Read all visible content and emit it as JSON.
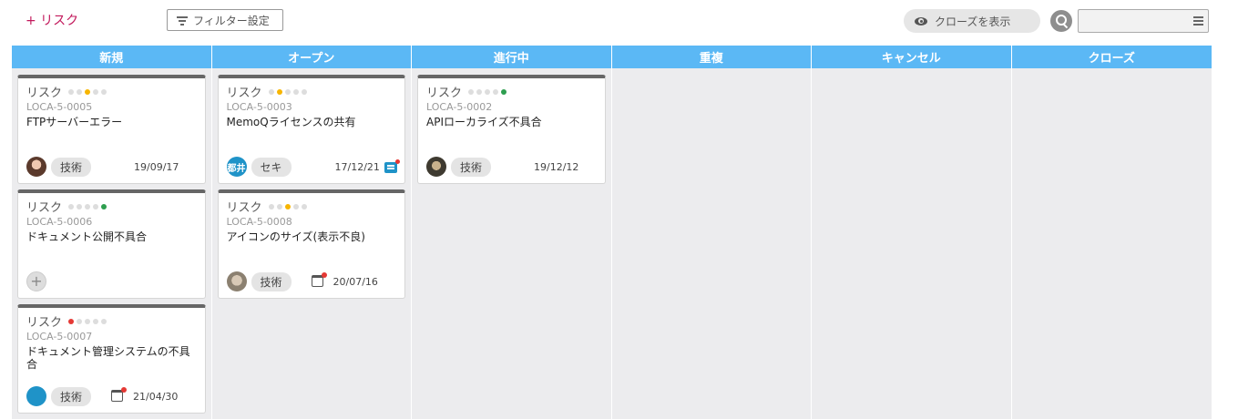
{
  "toolbar": {
    "add_label": "+ リスク",
    "filter_label": "フィルター設定",
    "show_closed_label": "クローズを表示",
    "search_placeholder": ""
  },
  "colors": {
    "column_header": "#5bb8f5",
    "board_bg": "#ececee",
    "priority_orange": "#f7b500",
    "priority_yellow": "#f4c042",
    "priority_green": "#2e9e4f",
    "priority_red": "#e53935",
    "add_link": "#c2185b"
  },
  "columns": [
    {
      "name": "新規",
      "cards": [
        {
          "type": "リスク",
          "priority": 3,
          "id": "LOCA-5-0005",
          "title": "FTPサーバーエラー",
          "tag": "技術",
          "date": "19/09/17",
          "avatar": "photo",
          "due_icon": false,
          "comment_icon": false
        },
        {
          "type": "リスク",
          "priority": 5,
          "id": "LOCA-5-0006",
          "title": "ドキュメント公開不具合",
          "tag": "",
          "date": "",
          "avatar": "add",
          "due_icon": false,
          "comment_icon": false
        },
        {
          "type": "リスク",
          "priority": 1,
          "id": "LOCA-5-0007",
          "title": "ドキュメント管理システムの不具合",
          "tag": "技術",
          "date": "21/04/30",
          "avatar": "photo",
          "due_icon": true,
          "comment_icon": false
        }
      ]
    },
    {
      "name": "オープン",
      "cards": [
        {
          "type": "リスク",
          "priority": 2,
          "id": "LOCA-5-0003",
          "title": "MemoQライセンスの共有",
          "tag": "セキ",
          "date": "17/12/21",
          "avatar": "都井",
          "due_icon": false,
          "comment_icon": true
        },
        {
          "type": "リスク",
          "priority": 3,
          "id": "LOCA-5-0008",
          "title": "アイコンのサイズ(表示不良)",
          "tag": "技術",
          "date": "20/07/16",
          "avatar": "photo",
          "due_icon": true,
          "comment_icon": false
        }
      ]
    },
    {
      "name": "進行中",
      "cards": [
        {
          "type": "リスク",
          "priority": 5,
          "id": "LOCA-5-0002",
          "title": "APIローカライズ不具合",
          "tag": "技術",
          "date": "19/12/12",
          "avatar": "photo",
          "due_icon": false,
          "comment_icon": false
        }
      ]
    },
    {
      "name": "重複",
      "cards": []
    },
    {
      "name": "キャンセル",
      "cards": []
    },
    {
      "name": "クローズ",
      "cards": []
    }
  ]
}
